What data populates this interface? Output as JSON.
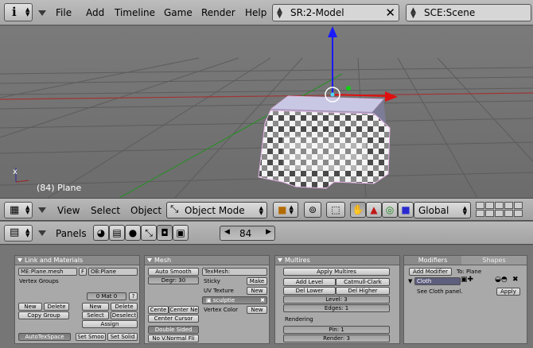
{
  "header": {
    "menus": [
      "File",
      "Add",
      "Timeline",
      "Game",
      "Render",
      "Help"
    ],
    "screen_field": "SR:2-Model",
    "scene_field": "SCE:Scene"
  },
  "viewport": {
    "object_label": "(84) Plane",
    "axis_label": "x"
  },
  "view_header": {
    "menus": [
      "View",
      "Select",
      "Object"
    ],
    "mode": "Object Mode",
    "orientation": "Global"
  },
  "buttons_header": {
    "panels_label": "Panels",
    "frame": "84"
  },
  "link_panel": {
    "title": "Link and Materials",
    "mesh_field": "ME:Plane.mesh",
    "f_label": "F",
    "ob_field": "OB:Plane",
    "vertex_groups": "Vertex Groups",
    "mat_field": "0 Mat 0",
    "question": "?",
    "new1": "New",
    "delete1": "Delete",
    "copy_group": "Copy Group",
    "new2": "New",
    "delete2": "Delete",
    "select": "Select",
    "deselect": "Deselect",
    "assign": "Assign",
    "autotex": "AutoTexSpace",
    "set_smooth": "Set Smoo",
    "set_solid": "Set Solid"
  },
  "mesh_panel": {
    "title": "Mesh",
    "auto_smooth": "Auto Smooth",
    "degr": "Degr: 30",
    "texmesh": "TexMesh:",
    "sticky": "Sticky",
    "make": "Make",
    "uv_texture": "UV Texture",
    "new": "New",
    "sculptie": "sculptie",
    "vertex_color": "Vertex Color",
    "new2": "New",
    "center": "Cente",
    "center_new": "Center Ne",
    "center_cursor": "Center Cursor",
    "double_sided": "Double Sided",
    "no_vnormal": "No V.Normal Fli"
  },
  "multires_panel": {
    "title": "Multires",
    "apply": "Apply Multires",
    "add_level": "Add Level",
    "catmull": "Catmull-Clark",
    "del_lower": "Del Lower",
    "del_higher": "Del Higher",
    "level": "Level: 3",
    "edges": "Edges: 1",
    "rendering": "Rendering",
    "pin": "Pin: 1",
    "render": "Render: 3"
  },
  "modifiers_panel": {
    "tab_modifiers": "Modifiers",
    "tab_shapes": "Shapes",
    "add_modifier": "Add Modifier",
    "to_plane": "To: Plane",
    "cloth": "Cloth",
    "see_cloth": "See Cloth panel.",
    "apply": "Apply"
  },
  "colors": {
    "z_axis": "#1a1aff",
    "x_axis": "#e01010",
    "y_axis": "#10c010",
    "grid_red": "#b03030",
    "grid_green": "#2a8a2a"
  }
}
